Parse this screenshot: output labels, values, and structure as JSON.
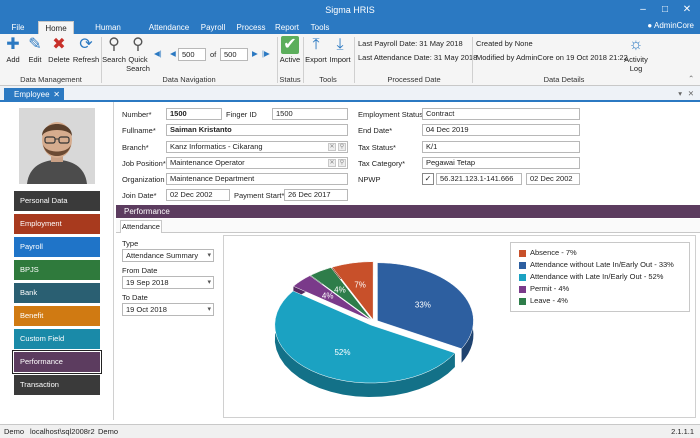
{
  "window": {
    "title": "Sigma HRIS"
  },
  "menu": {
    "tabs": [
      "File",
      "Home",
      "Human Resources",
      "Attendance",
      "Payroll",
      "Process",
      "Report",
      "Tools"
    ],
    "user": "AdminCore"
  },
  "ribbon": {
    "add": "Add",
    "edit": "Edit",
    "delete": "Delete",
    "refresh": "Refresh",
    "search": "Search",
    "quick_search": "Quick Search",
    "page_value": "500",
    "page_of": "of",
    "page_total": "500",
    "active": "Active",
    "export": "Export",
    "import": "Import",
    "last_payroll": "Last Payroll Date: 31 May 2018",
    "last_attendance": "Last Attendance Date: 31 May 2018",
    "created_by": "Created by None",
    "modified_by": "Modified by AdminCore on 19 Oct 2018  21:22",
    "activity_log": "Activity Log",
    "groups": [
      "Data Management",
      "Data Navigation",
      "Status",
      "Tools",
      "Processed Date",
      "Data Details"
    ]
  },
  "doc_tab": {
    "label": "Employee"
  },
  "sidebar": {
    "items": [
      {
        "label": "Personal Data",
        "color": "#3a3a3a"
      },
      {
        "label": "Employment",
        "color": "#a83a1e"
      },
      {
        "label": "Payroll",
        "color": "#1f74c8"
      },
      {
        "label": "BPJS",
        "color": "#2f7a3c"
      },
      {
        "label": "Bank",
        "color": "#2a5f72"
      },
      {
        "label": "Benefit",
        "color": "#d07a12"
      },
      {
        "label": "Custom Field",
        "color": "#1a8aa8"
      },
      {
        "label": "Performance",
        "color": "#5c3c5f"
      },
      {
        "label": "Transaction",
        "color": "#3a3a3a"
      }
    ]
  },
  "form": {
    "number_label": "Number*",
    "number": "1500",
    "finger_label": "Finger ID",
    "finger": "1500",
    "fullname_label": "Fullname*",
    "fullname": "Saiman Kristanto",
    "branch_label": "Branch*",
    "branch": "Kanz Informatics - Cikarang",
    "position_label": "Job Position*",
    "position": "Maintenance Operator",
    "org_label": "Organization",
    "org": "Maintenance Department",
    "join_label": "Join Date*",
    "join": "02 Dec 2002",
    "paystart_label": "Payment Start*",
    "paystart": "26 Dec 2017",
    "empstatus_label": "Employment Status*",
    "empstatus": "Contract",
    "enddate_label": "End Date*",
    "enddate": "04 Dec 2019",
    "taxstatus_label": "Tax Status*",
    "taxstatus": "K/1",
    "taxcat_label": "Tax Category*",
    "taxcat": "Pegawai Tetap",
    "npwp_label": "NPWP",
    "npwp": "56.321.123.1-141.666",
    "npwp_date": "02 Dec 2002"
  },
  "performance": {
    "header": "Performance",
    "subtab": "Attendance",
    "type_label": "Type",
    "type": "Attendance Summary",
    "from_label": "From Date",
    "from": "19 Sep 2018",
    "to_label": "To Date",
    "to": "19 Oct 2018"
  },
  "chart_data": {
    "type": "pie",
    "slices": [
      {
        "label": "Absence - 7%",
        "value": 7,
        "pct": "7%",
        "color": "#c8502a"
      },
      {
        "label": "Attendance without Late In/Early Out - 33%",
        "value": 33,
        "pct": "33%",
        "color": "#2d5fa0"
      },
      {
        "label": "Attendance with Late In/Early Out - 52%",
        "value": 52,
        "pct": "52%",
        "color": "#1ba2c2"
      },
      {
        "label": "Permit - 4%",
        "value": 4,
        "pct": "4%",
        "color": "#7a3a8a"
      },
      {
        "label": "Leave - 4%",
        "value": 4,
        "pct": "4%",
        "color": "#2e7d4a"
      }
    ],
    "legend": "top-right"
  },
  "status": {
    "user": "Demo",
    "server": "localhost\\sql2008r2",
    "db": "Demo",
    "version": "2.1.1.1"
  }
}
